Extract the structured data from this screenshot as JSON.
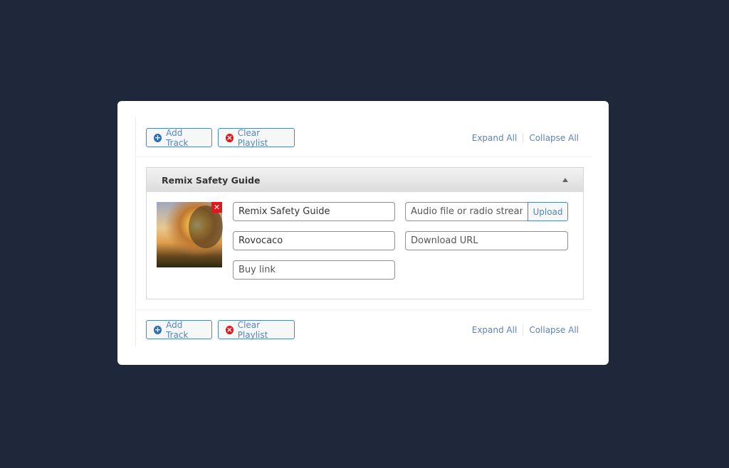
{
  "toolbar": {
    "add_track": "Add Track",
    "clear_playlist": "Clear Playlist",
    "expand_all": "Expand All",
    "collapse_all": "Collapse All"
  },
  "track": {
    "header_title": "Remix Safety Guide",
    "title_value": "Remix Safety Guide",
    "artist_value": "Rovocaco",
    "buy_link_placeholder": "Buy link",
    "audio_placeholder": "Audio file or radio stream",
    "download_placeholder": "Download URL",
    "upload_label": "Upload",
    "remove_image_icon": "✕"
  },
  "colors": {
    "accent": "#4f86c0",
    "danger": "#e0161b",
    "background": "#1f283b"
  }
}
